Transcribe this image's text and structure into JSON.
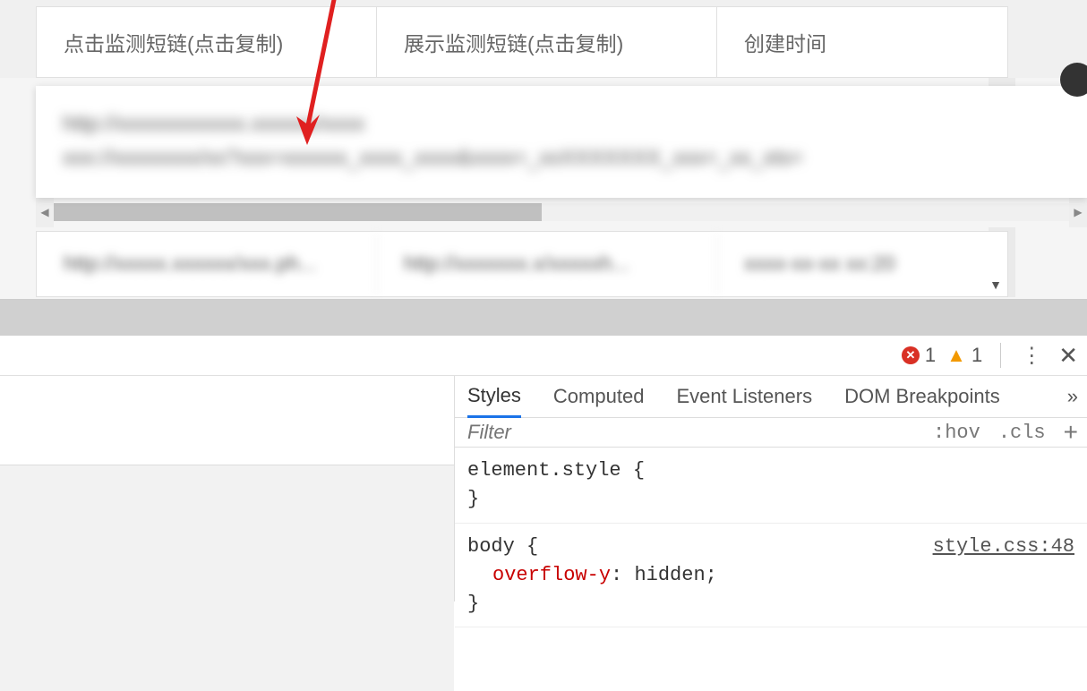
{
  "table": {
    "headers": {
      "col1": "点击监测短链(点击复制)",
      "col2": "展示监测短链(点击复制)",
      "col3": "创建时间"
    },
    "tooltip_line1": "http://xxxxxxxxxxxx.xxxxxx/xxxx",
    "tooltip_line2": "xxx://xxxxxxxx/xx?xxx=xxxxxx_xxxx_xxxx&xxxx=_xxXXXXXXX_xxx=_xx_xts=",
    "row": {
      "col1": "http://xxxxx.xxxxxx/xxx.ph...",
      "col2": "http://xxxxxxx.x/xxxxxh...",
      "col3": "xxxx-xx-xx xx:20"
    }
  },
  "devtools": {
    "errors": "1",
    "warnings": "1",
    "tabs": {
      "styles": "Styles",
      "computed": "Computed",
      "listeners": "Event Listeners",
      "dom": "DOM Breakpoints",
      "expand": "»"
    },
    "filter_placeholder": "Filter",
    "hov": ":hov",
    "cls": ".cls",
    "plus": "+",
    "css1": {
      "selector": "element.style {",
      "close": "}"
    },
    "css2": {
      "selector": "body {",
      "prop": "overflow-y",
      "value": "hidden",
      "close": "}",
      "source": "style.css:48"
    }
  },
  "icons": {
    "error_glyph": "✕",
    "warn_glyph": "▲",
    "kebab": "⋮",
    "close": "✕",
    "caret_down": "▼",
    "arrow_left": "◀",
    "arrow_right": "▶"
  }
}
